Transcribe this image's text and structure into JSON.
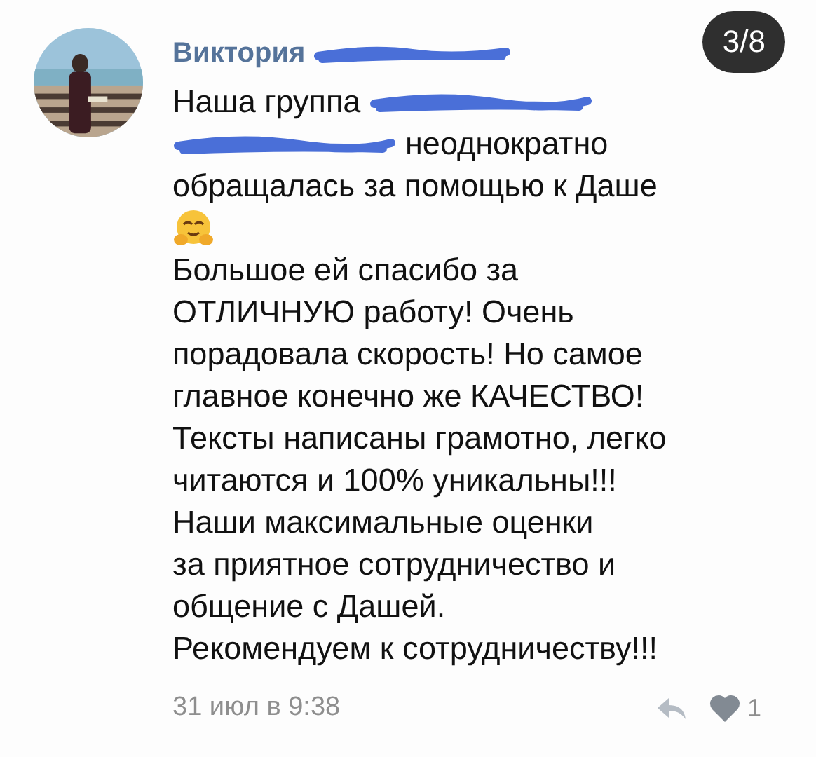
{
  "counter": "3/8",
  "comment": {
    "author": "Виктория",
    "author_redacted": true,
    "lines": [
      [
        {
          "kind": "text",
          "text": "Наша группа"
        },
        {
          "kind": "redacted"
        }
      ],
      [
        {
          "kind": "redacted"
        },
        {
          "kind": "text",
          "text": "неоднократно"
        }
      ],
      [
        {
          "kind": "text",
          "text": "обращалась за помощью к Даше"
        }
      ],
      [
        {
          "kind": "emoji"
        }
      ],
      [
        {
          "kind": "text",
          "text": "Большое ей спасибо за"
        }
      ],
      [
        {
          "kind": "text",
          "text": "ОТЛИЧНУЮ работу! Очень"
        }
      ],
      [
        {
          "kind": "text",
          "text": "порадовала скорость! Но самое"
        }
      ],
      [
        {
          "kind": "text",
          "text": "главное конечно же КАЧЕСТВО!"
        }
      ],
      [
        {
          "kind": "text",
          "text": "Тексты написаны грамотно, легко"
        }
      ],
      [
        {
          "kind": "text",
          "text": "читаются и 100% уникальны!!!"
        }
      ],
      [
        {
          "kind": "text",
          "text": "Наши максимальные оценки"
        }
      ],
      [
        {
          "kind": "text",
          "text": "за приятное сотрудничество и"
        }
      ],
      [
        {
          "kind": "text",
          "text": "общение с Дашей."
        }
      ],
      [
        {
          "kind": "text",
          "text": "Рекомендуем к сотрудничеству!!!"
        }
      ]
    ],
    "date": "31 июл в 9:38",
    "likes": "1"
  }
}
